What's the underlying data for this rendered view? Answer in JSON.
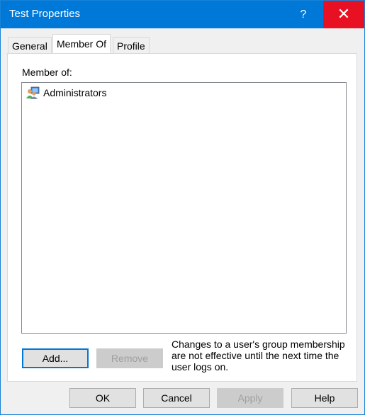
{
  "window": {
    "title": "Test Properties",
    "help_label": "?",
    "close_label": "✕"
  },
  "tabs": [
    {
      "label": "General"
    },
    {
      "label": "Member Of",
      "active": true
    },
    {
      "label": "Profile"
    }
  ],
  "member_of": {
    "label": "Member of:",
    "items": [
      {
        "name": "Administrators",
        "icon": "group-icon"
      }
    ]
  },
  "actions": {
    "add": "Add...",
    "remove": "Remove",
    "note": "Changes to a user's group membership are not effective until the next time the user logs on."
  },
  "footer": {
    "ok": "OK",
    "cancel": "Cancel",
    "apply": "Apply",
    "help": "Help"
  },
  "colors": {
    "titlebar": "#0078d7",
    "close": "#e81123"
  }
}
